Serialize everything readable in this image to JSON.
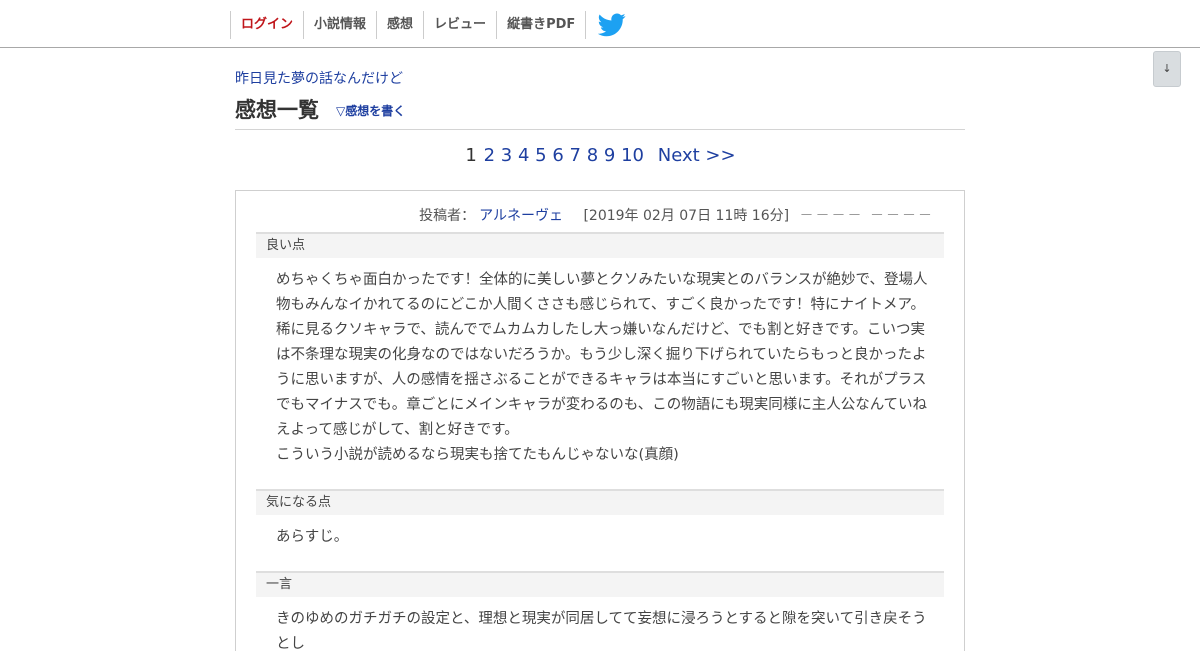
{
  "nav": {
    "items": [
      "ログイン",
      "小説情報",
      "感想",
      "レビュー",
      "縦書きPDF"
    ],
    "twitter_icon": "twitter-bird-icon"
  },
  "scroll_button": "↓",
  "novel_title": "昨日見た夢の話なんだけど",
  "page_heading": "感想一覧",
  "write_link": "▽感想を書く",
  "pager": {
    "pages": [
      "1",
      "2",
      "3",
      "4",
      "5",
      "6",
      "7",
      "8",
      "9",
      "10"
    ],
    "current": "1",
    "next": "Next >>"
  },
  "review": {
    "poster_label": "投稿者：",
    "poster_name": "アルネーヴェ",
    "date": "[2019年 02月 07日 11時 16分]",
    "dash": "－－－－ －－－－",
    "sections": [
      {
        "heading": "良い点",
        "paragraphs": [
          "めちゃくちゃ面白かったです！全体的に美しい夢とクソみたいな現実とのバランスが絶妙で、登場人物もみんなイかれてるのにどこか人間くささも感じられて、すごく良かったです！特にナイトメア。稀に見るクソキャラで、読んででムカムカしたし大っ嫌いなんだけど、でも割と好きです。こいつ実は不条理な現実の化身なのではないだろうか。もう少し深く掘り下げられていたらもっと良かったように思いますが、人の感情を揺さぶることができるキャラは本当にすごいと思います。それがプラスでもマイナスでも。章ごとにメインキャラが変わるのも、この物語にも現実同様に主人公なんていねえよって感じがして、割と好きです。",
          "こういう小説が読めるなら現実も捨てたもんじゃないな(真顔)"
        ]
      },
      {
        "heading": "気になる点",
        "paragraphs": [
          "あらすじ。"
        ]
      },
      {
        "heading": "一言",
        "paragraphs": [
          "きのゆめのガチガチの設定と、理想と現実が同居してて妄想に浸ろうとすると隙を突いて引き戻そうとし"
        ]
      }
    ]
  },
  "colors": {
    "link": "#1e3fa0",
    "login": "#c0161b",
    "twitter": "#1da1f2"
  }
}
